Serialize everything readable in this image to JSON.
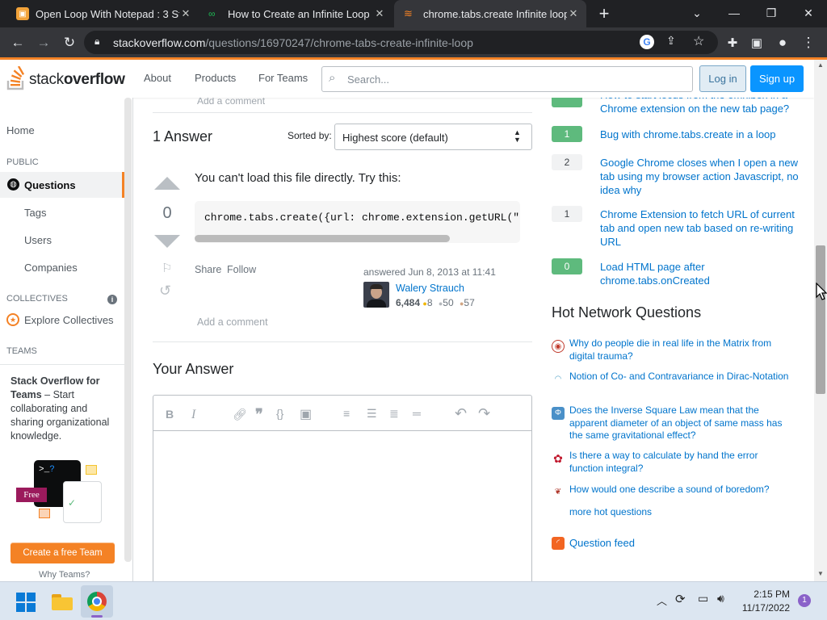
{
  "browser": {
    "tabs": [
      {
        "title": "Open Loop With Notepad : 3 Ste",
        "active": false
      },
      {
        "title": "How to Create an Infinite Loop in",
        "active": false
      },
      {
        "title": "chrome.tabs.create Infinite loop?",
        "active": true
      }
    ],
    "new_tab_icon": "plus-icon",
    "url_domain": "stackoverflow.com",
    "url_path": "/questions/16970247/chrome-tabs-create-infinite-loop"
  },
  "so_header": {
    "logo_stack": "stack",
    "logo_overflow": "overflow",
    "nav": [
      "About",
      "Products",
      "For Teams"
    ],
    "search_placeholder": "Search...",
    "login": "Log in",
    "signup": "Sign up"
  },
  "left_nav": {
    "home": "Home",
    "public": "PUBLIC",
    "questions": "Questions",
    "tags": "Tags",
    "users": "Users",
    "companies": "Companies",
    "collectives": "COLLECTIVES",
    "explore_collectives": "Explore Collectives",
    "teams": "TEAMS",
    "teams_title": "Stack Overflow for Teams",
    "teams_dash": " – Start collaborating and sharing organizational knowledge.",
    "free_badge": "Free",
    "create_team": "Create a free Team",
    "why_teams": "Why Teams?"
  },
  "main": {
    "add_comment_top": "Add a comment",
    "answers_heading": "1 Answer",
    "sorted_by": "Sorted by:",
    "sort_value": "Highest score (default)",
    "answer": {
      "score": "0",
      "text": "You can't load this file directly. Try this:",
      "code": "chrome.tabs.create({url: chrome.extension.getURL(\"te",
      "share": "Share",
      "follow": "Follow",
      "answered": "answered Jun 8, 2013 at 11:41",
      "user": "Walery Strauch",
      "rep": "6,484",
      "gold": "8",
      "silver": "50",
      "bronze": "57",
      "add_comment": "Add a comment"
    },
    "your_answer": "Your Answer"
  },
  "related": [
    {
      "score": "",
      "text": "How to start locus from the omnibox in a Chrome extension on the new tab page?",
      "green": true
    },
    {
      "score": "1",
      "text": "Bug with chrome.tabs.create in a loop",
      "green": true
    },
    {
      "score": "2",
      "text": "Google Chrome closes when I open a new tab using my browser action Javascript, no idea why",
      "green": false
    },
    {
      "score": "1",
      "text": "Chrome Extension to fetch URL of current tab and open new tab based on re-writing URL",
      "green": false
    },
    {
      "score": "0",
      "text": "Load HTML page after chrome.tabs.onCreated",
      "green": true
    }
  ],
  "hot_network": {
    "heading": "Hot Network Questions",
    "items": [
      "Why do people die in real life in the Matrix from digital trauma?",
      "Notion of Co- and Contravariance in Dirac-Notation",
      "Does the Inverse Square Law mean that the apparent diameter of an object of same mass has the same gravitational effect?",
      "Is there a way to calculate by hand the error function integral?",
      "How would one describe a sound of boredom?"
    ],
    "more": "more hot questions",
    "feed": "Question feed"
  },
  "taskbar": {
    "time": "2:15 PM",
    "date": "11/17/2022",
    "notif_count": "1"
  },
  "colors": {
    "accent": "#f48225",
    "link": "#0074cc",
    "green": "#5eba7d",
    "button_blue": "#0a95ff"
  }
}
